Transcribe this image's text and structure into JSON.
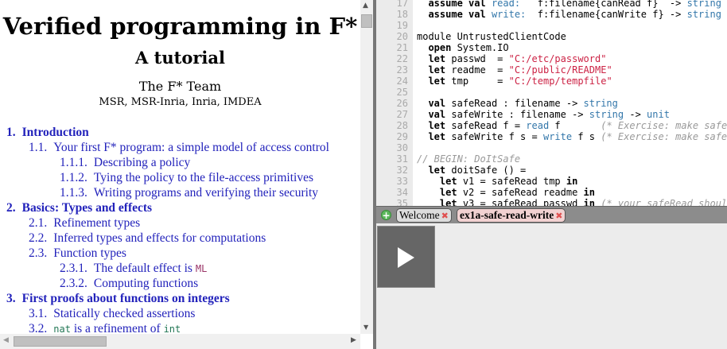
{
  "doc": {
    "title": "Verified programming in F*",
    "subtitle": "A tutorial",
    "author": "The F* Team",
    "affiliations": "MSR, MSR-Inria, Inria, IMDEA",
    "toc": [
      {
        "level": 1,
        "num": "1.",
        "text": "Introduction"
      },
      {
        "level": 2,
        "num": "1.1.",
        "text": "Your first F* program: a simple model of access control"
      },
      {
        "level": 3,
        "num": "1.1.1.",
        "text": "Describing a policy"
      },
      {
        "level": 3,
        "num": "1.1.2.",
        "text": "Tying the policy to the file-access primitives"
      },
      {
        "level": 3,
        "num": "1.1.3.",
        "text": "Writing programs and verifying their security"
      },
      {
        "level": 1,
        "num": "2.",
        "text": "Basics: Types and effects"
      },
      {
        "level": 2,
        "num": "2.1.",
        "text": "Refinement types"
      },
      {
        "level": 2,
        "num": "2.2.",
        "text": "Inferred types and effects for computations"
      },
      {
        "level": 2,
        "num": "2.3.",
        "text": "Function types"
      },
      {
        "level": 3,
        "num": "2.3.1.",
        "text": "The default effect is ",
        "code": "ML"
      },
      {
        "level": 3,
        "num": "2.3.2.",
        "text": "Computing functions"
      },
      {
        "level": 1,
        "num": "3.",
        "text": "First proofs about functions on integers"
      },
      {
        "level": 2,
        "num": "3.1.",
        "text": "Statically checked assertions"
      },
      {
        "level": 2,
        "num": "3.2.",
        "code1": "nat",
        "text": " is a refinement of ",
        "code2": "int"
      }
    ]
  },
  "editor": {
    "lines": [
      {
        "n": "17",
        "html": "  <span class=kw>assume val</span> <span class=bl>read:</span>   f:filename{canRead f}  -> <span class=bl>string</span>"
      },
      {
        "n": "18",
        "html": "  <span class=kw>assume val</span> <span class=bl>write:</span>  f:filename{canWrite f} -> <span class=bl>string</span> ->"
      },
      {
        "n": "19",
        "html": ""
      },
      {
        "n": "20",
        "html": "module UntrustedClientCode"
      },
      {
        "n": "21",
        "html": "  <span class=kw>open</span> System.IO"
      },
      {
        "n": "22",
        "html": "  <span class=kw>let</span> passwd  = <span class=st>\"C:/etc/password\"</span>"
      },
      {
        "n": "23",
        "html": "  <span class=kw>let</span> readme  = <span class=st>\"C:/public/README\"</span>"
      },
      {
        "n": "24",
        "html": "  <span class=kw>let</span> tmp     = <span class=st>\"C:/temp/tempfile\"</span>"
      },
      {
        "n": "25",
        "html": ""
      },
      {
        "n": "26",
        "html": "  <span class=kw>val</span> safeRead : filename -> <span class=bl>string</span>"
      },
      {
        "n": "27",
        "html": "  <span class=kw>val</span> safeWrite : filename -> <span class=bl>string</span> -> <span class=bl>unit</span>"
      },
      {
        "n": "28",
        "html": "  <span class=kw>let</span> safeRead f = <span class=bl>read</span> f       <span class=cm>(* Exercise: make safeRead</span>"
      },
      {
        "n": "29",
        "html": "  <span class=kw>let</span> safeWrite f s = <span class=bl>write</span> f s <span class=cm>(* Exercise: make safeWrite</span>"
      },
      {
        "n": "30",
        "html": ""
      },
      {
        "n": "31",
        "html": "<span class=cm>// BEGIN: DoItSafe</span>"
      },
      {
        "n": "32",
        "html": "  <span class=kw>let</span> doitSafe () ="
      },
      {
        "n": "33",
        "html": "    <span class=kw>let</span> v1 = safeRead tmp <span class=kw>in</span>"
      },
      {
        "n": "34",
        "html": "    <span class=kw>let</span> v2 = safeRead readme <span class=kw>in</span>"
      },
      {
        "n": "35",
        "html": "    <span class=kw>let</span> v3 = safeRead passwd <span class=kw>in</span> <span class=cm>(* your safeRead should</span>"
      }
    ]
  },
  "tabs": [
    {
      "label": "Welcome"
    },
    {
      "label": "ex1a-safe-read-write"
    }
  ],
  "icons": {
    "close": "✖",
    "add": "+"
  }
}
